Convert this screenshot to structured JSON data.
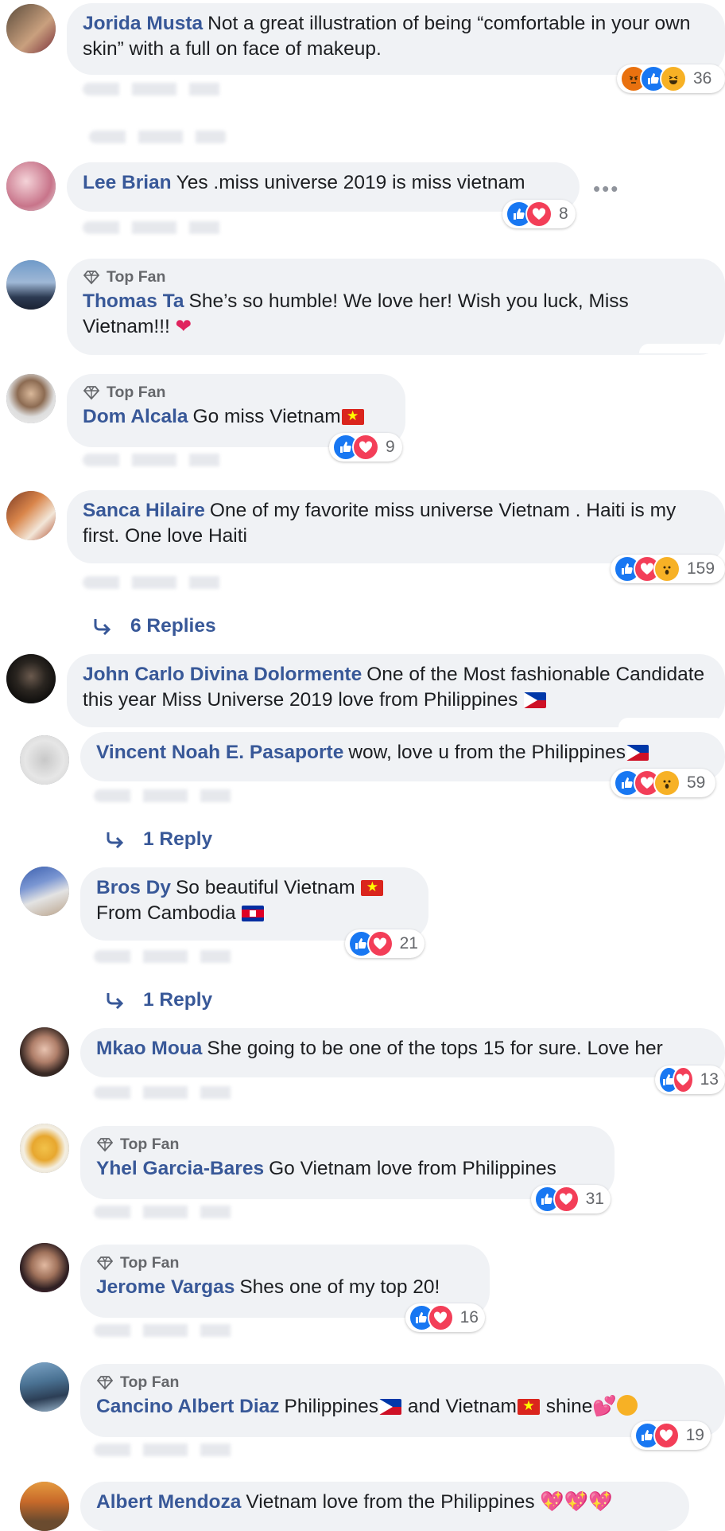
{
  "comments": [
    {
      "name": "Jorida Musta",
      "text": "Not a great illustration of being “comfortable in your own skin” with a full on face of makeup.",
      "count": "36",
      "top_fan": ""
    },
    {
      "name": "Lee Brian",
      "text": "Yes .miss universe 2019 is miss vietnam",
      "count": "8",
      "top_fan": "",
      "more": "•••"
    },
    {
      "name": "Thomas Ta",
      "text": "She’s so humble! We love her! Wish you luck, Miss Vietnam!!!",
      "count": "",
      "top_fan": "Top Fan"
    },
    {
      "name": "Dom Alcala",
      "text": "Go miss Vietnam",
      "count": "9",
      "top_fan": "Top Fan"
    },
    {
      "name": "Sanca Hilaire",
      "text": "One of my favorite miss universe Vietnam . Haiti is my first. One love Haiti",
      "count": "159",
      "top_fan": "",
      "replies": "6 Replies"
    },
    {
      "name": "John Carlo Divina Dolormente",
      "text": "One of the Most fashionable Candidate this year Miss Universe 2019 love from Philippines",
      "count": "",
      "top_fan": ""
    },
    {
      "name": "Vincent Noah E. Pasaporte",
      "text": "wow, love u from the Philippines",
      "count": "59",
      "top_fan": "",
      "replies": "1 Reply"
    },
    {
      "name": "Bros Dy",
      "text": "So beautiful Vietnam",
      "text2": "From Cambodia",
      "count": "21",
      "top_fan": "",
      "replies": "1 Reply"
    },
    {
      "name": "Mkao Moua",
      "text": "She going to be one of the tops 15 for sure. Love her",
      "count": "13",
      "top_fan": ""
    },
    {
      "name": "Yhel Garcia-Bares",
      "text": "Go Vietnam love from Philippines",
      "count": "31",
      "top_fan": "Top Fan"
    },
    {
      "name": "Jerome Vargas",
      "text": "Shes one of my top 20!",
      "count": "16",
      "top_fan": "Top Fan"
    },
    {
      "name": "Cancino Albert Diaz",
      "text": "Philippines",
      "text_mid": "and Vietnam",
      "text_end": "shine",
      "count": "19",
      "top_fan": "Top Fan"
    },
    {
      "name": "Albert Mendoza",
      "text": "Vietnam love from the Philippines",
      "count": "",
      "top_fan": ""
    }
  ],
  "icons": {
    "top_fan_badge": "diamond-badge-icon",
    "reply_arrow": "reply-arrow-icon",
    "reactions": [
      "like-icon",
      "love-icon",
      "angry-icon",
      "haha-icon",
      "wow-icon"
    ]
  },
  "colors": {
    "name": "#385898",
    "bubble": "#f0f2f5",
    "like": "#1877f2",
    "love": "#f33e58",
    "muted": "#65676b"
  }
}
